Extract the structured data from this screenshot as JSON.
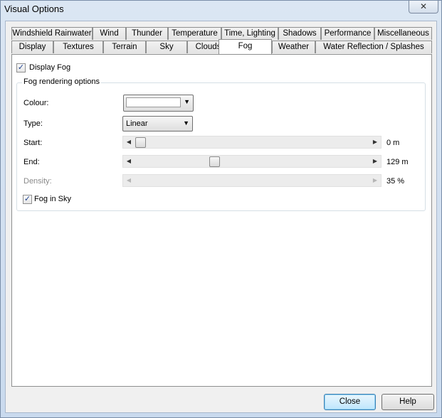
{
  "window": {
    "title": "Visual Options",
    "close_glyph": "✕"
  },
  "tabs_row1": [
    {
      "label": "Windshield Rainwater"
    },
    {
      "label": "Wind"
    },
    {
      "label": "Thunder"
    },
    {
      "label": "Temperature"
    },
    {
      "label": "Time, Lighting"
    },
    {
      "label": "Shadows"
    },
    {
      "label": "Performance"
    },
    {
      "label": "Miscellaneous"
    }
  ],
  "tabs_row2": [
    {
      "label": "Display"
    },
    {
      "label": "Textures"
    },
    {
      "label": "Terrain"
    },
    {
      "label": "Sky"
    },
    {
      "label": "Clouds"
    },
    {
      "label": "Fog",
      "active": true
    },
    {
      "label": "Weather"
    },
    {
      "label": "Water Reflection / Splashes"
    }
  ],
  "fog": {
    "display_fog": {
      "label": "Display Fog",
      "checked": true
    },
    "group_title": "Fog rendering options",
    "colour": {
      "label": "Colour:",
      "value_color": "#ffffff"
    },
    "type": {
      "label": "Type:",
      "value": "Linear"
    },
    "start": {
      "label": "Start:",
      "value_text": "0 m",
      "position": 0.0
    },
    "end": {
      "label": "End:",
      "value_text": "129 m",
      "position": 0.33
    },
    "density": {
      "label": "Density:",
      "value_text": "35 %",
      "enabled": false
    },
    "fog_in_sky": {
      "label": "Fog in Sky",
      "checked": true
    }
  },
  "footer": {
    "close_label": "Close",
    "help_label": "Help"
  },
  "glyphs": {
    "check": "✓",
    "dropdown_arrow": "▼",
    "scroll_left": "◀",
    "scroll_right": "▶"
  }
}
